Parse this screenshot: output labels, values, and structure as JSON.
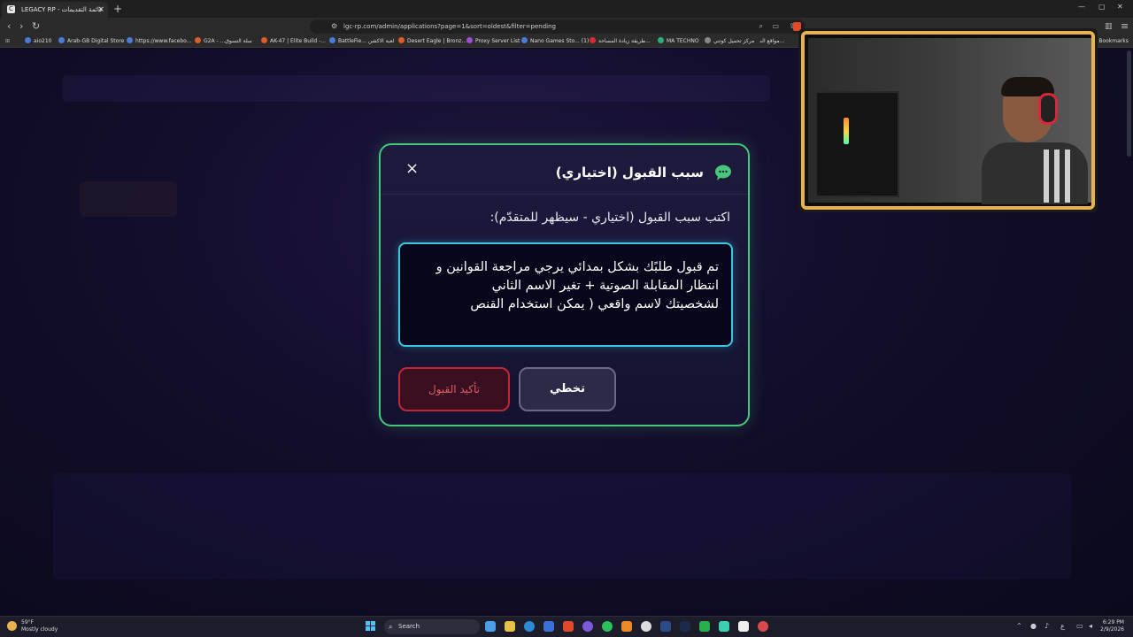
{
  "browser": {
    "tab_title": "LEGACY RP - قائمة التقديمات",
    "tab_favicon": "C",
    "new_tab": "+",
    "url": "lgc-rp.com/admin/applications?page=1&sort=oldest&filter=pending",
    "bookmarks": [
      "aio210",
      "Arab-GB Digital Store",
      "https://www.facebo...",
      "G2A - ...سلة التسوق",
      "AK-47 | Elite Build -...",
      "BattleFie... لعبة الاكشن",
      "Desert Eagle | Bronz...",
      "Proxy Server List",
      "Nano Games Sto... (1)",
      "طريقة زيادة المساحة...",
      "MA TECHNO",
      "مركز تحميل كوتني",
      "مواقع الد...",
      "All Bookmarks"
    ]
  },
  "modal": {
    "title": "سبب القبول (اختياري)",
    "close": "×",
    "field_label": "اكتب سبب القبول (اختياري - سيظهر للمتقدّم):",
    "textarea_value": "تم قبول طلبًك بشكل بمدائي يرجي مراجعة القوانين و\nانتظار المقابلة الصوتية + تغير الاسم الثاني\nلشخصيتك لاسم واقعي ( يمكن استخدام القنص",
    "skip_label": "تخطي",
    "confirm_label": "تأكيد القبول",
    "accent_color": "#46c77a",
    "input_border_color": "#3cc7e0",
    "danger_color": "#c0283a"
  },
  "taskbar": {
    "weather_temp": "59°F",
    "weather_desc": "Mostly cloudy",
    "search_placeholder": "Search",
    "time": "6:29 PM",
    "date": "2/9/2026"
  }
}
